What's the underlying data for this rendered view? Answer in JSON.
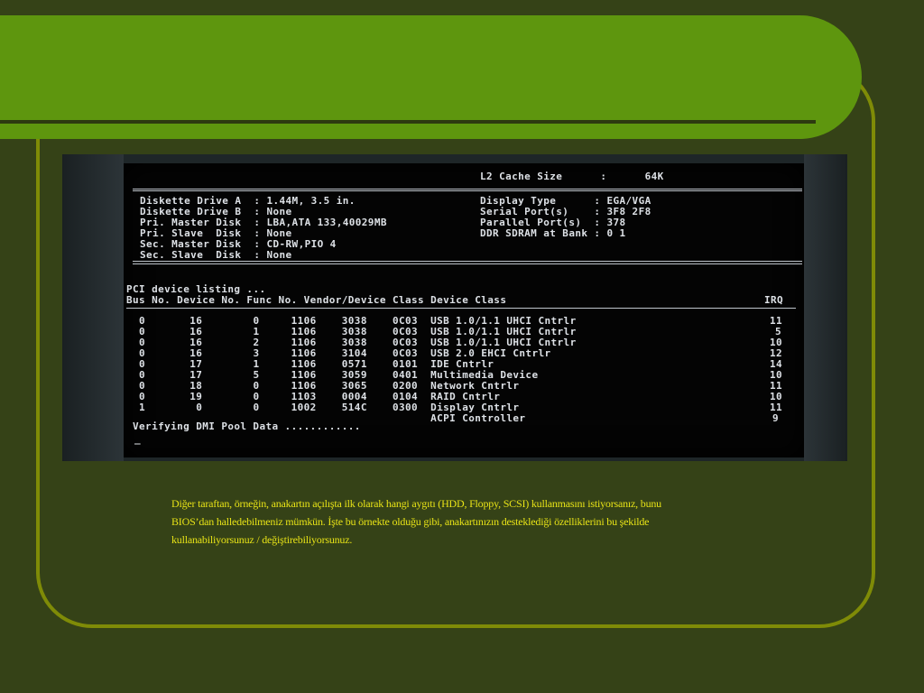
{
  "bios": {
    "cache_line": "L2 Cache Size      :      64K",
    "drives_left": [
      "Diskette Drive A  : 1.44M, 3.5 in.",
      "Diskette Drive B  : None",
      "Pri. Master Disk  : LBA,ATA 133,40029MB",
      "Pri. Slave  Disk  : None",
      "Sec. Master Disk  : CD-RW,PIO 4",
      "Sec. Slave  Disk  : None"
    ],
    "drives_right": [
      "Display Type      : EGA/VGA",
      "Serial Port(s)    : 3F8 2F8",
      "Parallel Port(s)  : 378",
      "DDR SDRAM at Bank : 0 1"
    ],
    "pci_title": "PCI device listing ...",
    "pci_header": "Bus No. Device No. Func No. Vendor/Device Class Device Class",
    "irq_header": "IRQ",
    "pci_rows": [
      "  0       16        0     1106    3038    0C03  USB 1.0/1.1 UHCI Cntrlr",
      "  0       16        1     1106    3038    0C03  USB 1.0/1.1 UHCI Cntrlr",
      "  0       16        2     1106    3038    0C03  USB 1.0/1.1 UHCI Cntrlr",
      "  0       16        3     1106    3104    0C03  USB 2.0 EHCI Cntrlr",
      "  0       17        1     1106    0571    0101  IDE Cntrlr",
      "  0       17        5     1106    3059    0401  Multimedia Device",
      "  0       18        0     1106    3065    0200  Network Cntrlr",
      "  0       19        0     1103    0004    0104  RAID Cntrlr",
      "  1        0        0     1002    514C    0300  Display Cntrlr",
      "                                                ACPI Controller"
    ],
    "irq_values": [
      "11",
      "5",
      "10",
      "12",
      "14",
      "10",
      "11",
      "10",
      "11",
      "9"
    ],
    "verifying": "Verifying DMI Pool Data ............",
    "cursor": "_"
  },
  "caption": {
    "line1": "Diğer taraftan, örneğin, anakartın açılışta ilk olarak hangi aygıtı (HDD, Floppy, SCSI) kullanmasını istiyorsanız, bunu",
    "line2": "BIOS’dan halledebilmeniz mümkün. İşte bu örnekte olduğu gibi, anakartınızın desteklediği özelliklerini bu şekilde",
    "line3": "kullanabiliyorsunuz / değiştirebiliyorsunuz."
  }
}
